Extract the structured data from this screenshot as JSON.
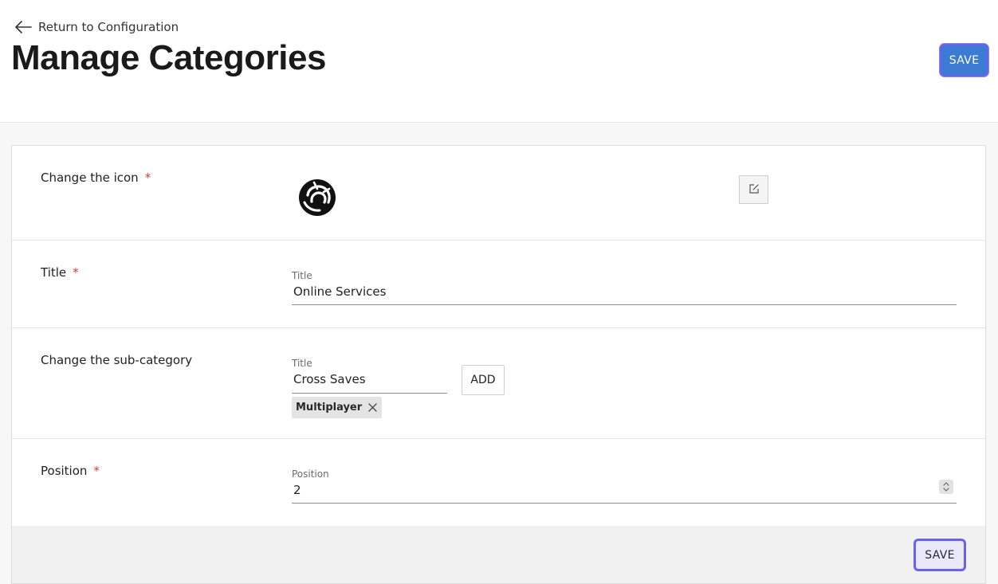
{
  "header": {
    "back_label": "Return to Configuration",
    "title": "Manage Categories",
    "save_label": "SAVE"
  },
  "rows": {
    "icon": {
      "label": "Change the icon",
      "required_mark": "*"
    },
    "title": {
      "label": "Title",
      "required_mark": "*",
      "field_label": "Title",
      "value": "Online Services"
    },
    "subcategory": {
      "label": "Change the sub-category",
      "field_label": "Title",
      "value": "Cross Saves",
      "add_label": "ADD",
      "tags": [
        "Multiplayer"
      ]
    },
    "position": {
      "label": "Position",
      "required_mark": "*",
      "field_label": "Position",
      "value": "2"
    }
  },
  "footer": {
    "save_label": "SAVE"
  },
  "colors": {
    "primary": "#3b7bd4",
    "focus_ring": "#6b63e6",
    "required": "#d43c3c"
  },
  "icons": {
    "back": "arrow-left-icon",
    "category": "category-logo-icon",
    "edit": "edit-icon",
    "tag_remove": "close-icon",
    "stepper": "stepper-icon"
  }
}
